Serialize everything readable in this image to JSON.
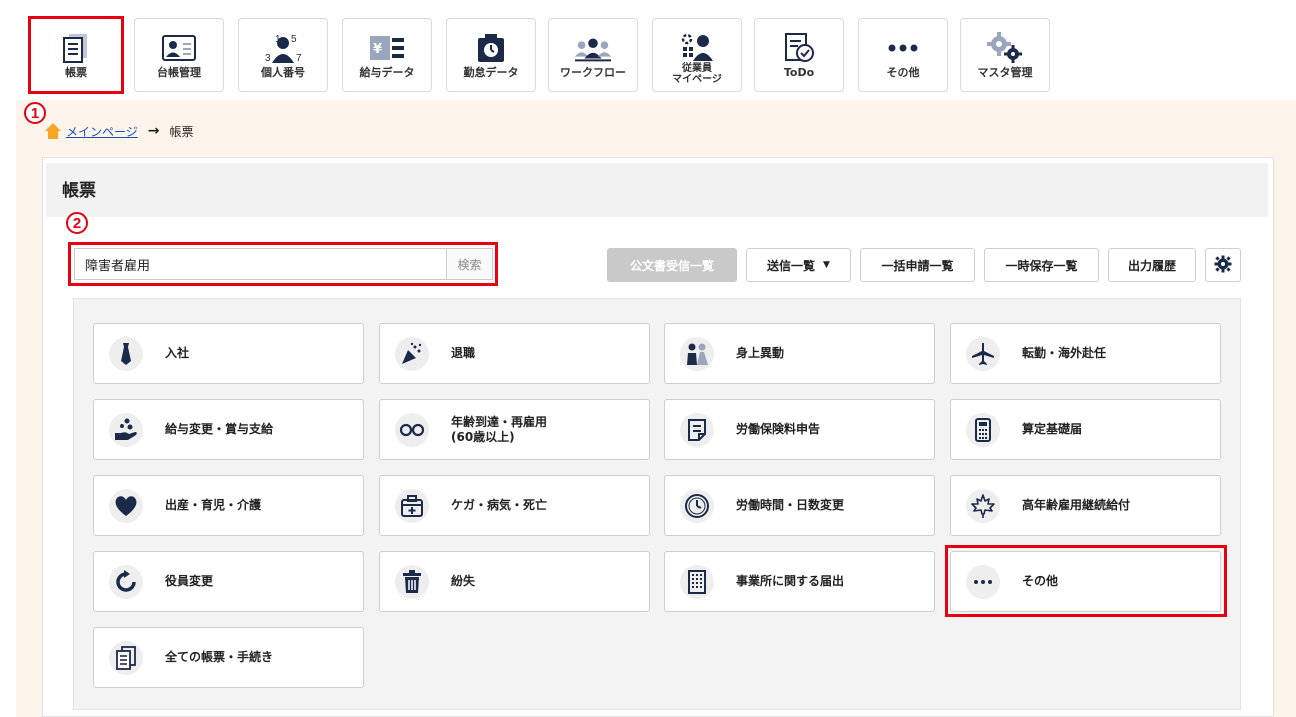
{
  "nav": [
    {
      "label": "帳票",
      "icon": "document-list-icon"
    },
    {
      "label": "台帳管理",
      "icon": "id-card-icon"
    },
    {
      "label": "個人番号",
      "icon": "person-number-icon"
    },
    {
      "label": "給与データ",
      "icon": "salary-icon"
    },
    {
      "label": "勤怠データ",
      "icon": "timecard-icon"
    },
    {
      "label": "ワークフロー",
      "icon": "workflow-icon"
    },
    {
      "label": "従業員\nマイページ",
      "icon": "employee-page-icon"
    },
    {
      "label": "ToDo",
      "icon": "todo-icon"
    },
    {
      "label": "その他",
      "icon": "more-icon"
    },
    {
      "label": "マスタ管理",
      "icon": "gears-icon"
    }
  ],
  "badges": {
    "one": "1",
    "two": "2"
  },
  "breadcrumb": {
    "home": "メインページ",
    "arrow": "→",
    "current": "帳票"
  },
  "page": {
    "title": "帳票"
  },
  "search": {
    "value": "障害者雇用",
    "button": "検索"
  },
  "toolbar": {
    "official_docs": "公文書受信一覧",
    "sent_list": "送信一覧",
    "bulk_apply": "一括申請一覧",
    "temp_saved": "一時保存一覧",
    "output_history": "出力履歴"
  },
  "cards": [
    {
      "label": "入社",
      "icon": "necktie-icon"
    },
    {
      "label": "退職",
      "icon": "party-popper-icon"
    },
    {
      "label": "身上異動",
      "icon": "wedding-couple-icon"
    },
    {
      "label": "転勤・海外赴任",
      "icon": "airplane-icon"
    },
    {
      "label": "給与変更・賞与支給",
      "icon": "coin-hand-icon"
    },
    {
      "label": "年齢到達・再雇用\n(60歳以上)",
      "icon": "glasses-icon"
    },
    {
      "label": "労働保険料申告",
      "icon": "note-icon"
    },
    {
      "label": "算定基礎届",
      "icon": "calculator-icon"
    },
    {
      "label": "出産・育児・介護",
      "icon": "heart-icon"
    },
    {
      "label": "ケガ・病気・死亡",
      "icon": "first-aid-kit-icon"
    },
    {
      "label": "労働時間・日数変更",
      "icon": "clock-icon"
    },
    {
      "label": "高年齢雇用継続給付",
      "icon": "maple-leaf-icon"
    },
    {
      "label": "役員変更",
      "icon": "refresh-icon"
    },
    {
      "label": "紛失",
      "icon": "trash-icon"
    },
    {
      "label": "事業所に関する届出",
      "icon": "building-icon"
    },
    {
      "label": "その他",
      "icon": "more-icon"
    },
    {
      "label": "全ての帳票・手続き",
      "icon": "documents-icon"
    }
  ],
  "colors": {
    "highlight": "#e60012",
    "link": "#1a4fb4",
    "content_bg": "#fdf5ec",
    "navy": "#1c2a4a"
  }
}
